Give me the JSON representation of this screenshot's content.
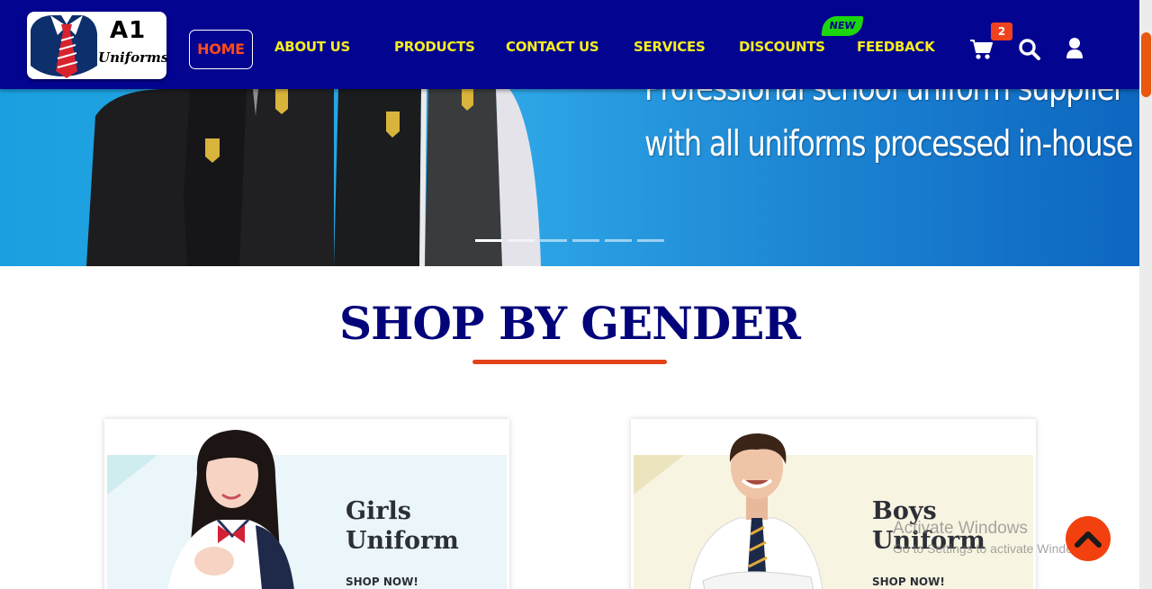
{
  "header": {
    "logo": {
      "brand_main": "A1",
      "brand_sub": "Uniforms"
    },
    "nav": {
      "home": "HOME",
      "about": "ABOUT US",
      "products": "PRODUCTS",
      "contact": "CONTACT US",
      "services": "SERVICES",
      "discounts": "DISCOUNTS",
      "feedback": "FEEDBACK"
    },
    "new_badge": "NEW",
    "cart_count": "2",
    "icons": [
      "cart-icon",
      "search-icon",
      "user-icon"
    ]
  },
  "hero": {
    "line1": "Professional school uniform supplier",
    "line2": "with all uniforms processed in-house",
    "slide_count": 6,
    "active_slide": 1
  },
  "section": {
    "title": "SHOP BY GENDER"
  },
  "cards": [
    {
      "title_line1": "Girls",
      "title_line2": "Uniform",
      "cta": "SHOP NOW!"
    },
    {
      "title_line1": "Boys",
      "title_line2": "Uniform",
      "cta": "SHOP NOW!"
    }
  ],
  "overlay": {
    "watermark_title": "Activate Windows",
    "watermark_sub": "Go to Settings to activate Windows."
  },
  "colors": {
    "nav_bg": "#03048f",
    "nav_text": "#f6ed1f",
    "nav_active": "#ff4a1a",
    "accent": "#e3431a",
    "title": "#03047a",
    "new_badge": "#1cd60e"
  }
}
